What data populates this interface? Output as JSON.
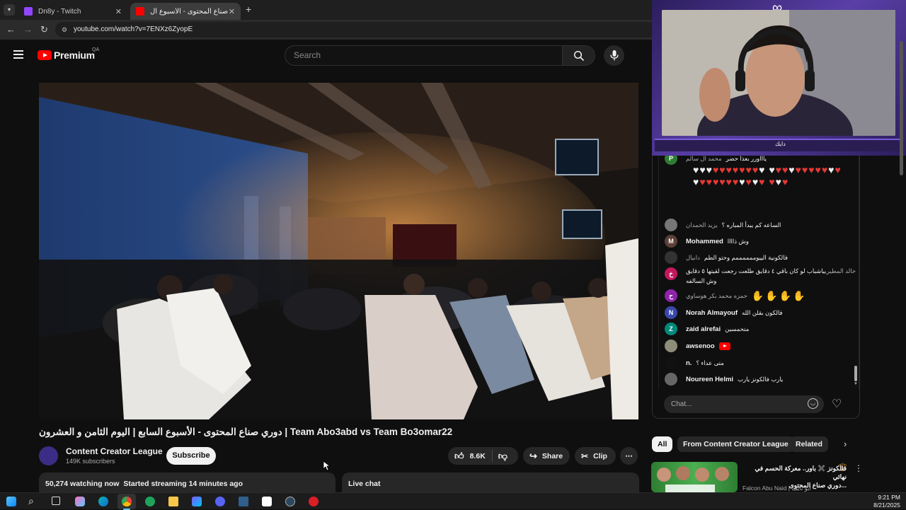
{
  "browser": {
    "tabs": [
      {
        "label": "Dn8y - Twitch",
        "active": false,
        "favicon_color": "#9146ff"
      },
      {
        "label": "دوري صناع المحتوى - الأسبوع ال...",
        "active": true,
        "favicon_color": "#ff0000"
      }
    ],
    "new_tab": "+",
    "url": "youtube.com/watch?v=7ENXz6ZyopE"
  },
  "youtube": {
    "logo_text": "Premium",
    "country_code": "QA",
    "search_placeholder": "Search"
  },
  "video": {
    "title": "دوري صناع المحتوى - الأسبوع السابع | اليوم الثامن و العشرون | Team Abo3abd vs Team Bo3omar22",
    "channel_name": "Content Creator League",
    "subscribers": "149K subscribers",
    "subscribe_label": "Subscribe",
    "likes": "8.6K",
    "share_label": "Share",
    "clip_label": "Clip",
    "more_label": "⋯",
    "watching": "50,274 watching now",
    "started": "Started streaming 14 minutes ago",
    "live_chat_label": "Live chat"
  },
  "chat": {
    "messages": [
      {
        "author": "محمد ال سالم",
        "text": "ياااورر بعذا حضر",
        "avatar_letter": "P",
        "avatar_color": "#2e7d32"
      },
      {
        "author": "يزيد الحمدان",
        "text": "الساعه كم يبدأ المباره ؟",
        "avatar_letter": "",
        "avatar_color": "#777777"
      },
      {
        "author": "Mohammed",
        "text": "وش ذاااا",
        "avatar_letter": "M",
        "avatar_color": "#5d4037"
      },
      {
        "author": "دانيال",
        "text": "فالكونية الييوممممممم وحتو الطم",
        "avatar_letter": "",
        "avatar_color": "#333333"
      },
      {
        "author": "خالد المطيري",
        "text": "ياشباب لو كان باقي ٤ دقايق طلعت رجعت لقيتها ٥ دقايق",
        "text2": "وش السالفه",
        "avatar_letter": "خ",
        "avatar_color": "#c2185b"
      },
      {
        "author": "حمزه محمد بكر هوساوي",
        "text": "",
        "avatar_letter": "ح",
        "avatar_color": "#8e24aa"
      },
      {
        "author": "Norah Almayouf",
        "text": "فالكون بقلن الله",
        "avatar_letter": "N",
        "avatar_color": "#3949ab"
      },
      {
        "author": "zaid alrefai",
        "text": "متحمسين",
        "avatar_letter": "Z",
        "avatar_color": "#00897b"
      },
      {
        "author": "awsenoo",
        "text": "",
        "avatar_letter": "",
        "avatar_color": "#8d8d7a"
      },
      {
        "author": "n.",
        "text": "متى عداء ؟",
        "avatar_letter": "",
        "avatar_color": "#111111"
      },
      {
        "author": "Noureen Helmi",
        "text": "يارب فالكونز يارب",
        "avatar_letter": "",
        "avatar_color": "#666666"
      }
    ],
    "input_placeholder": "Chat..."
  },
  "filters": [
    "All",
    "From Content Creator League",
    "Related"
  ],
  "recommendation": {
    "title_line1": "فالكونز ✖️ باور.. معركة الحسم في نهائي",
    "title_line2": "دوري صناع المحتوى...",
    "channel": "Falcon Abu Naid | ابو نايف"
  },
  "webcam": {
    "username": "دايك"
  },
  "taskbar": {
    "time": "9:21 PM",
    "date": "8/21/2025"
  }
}
